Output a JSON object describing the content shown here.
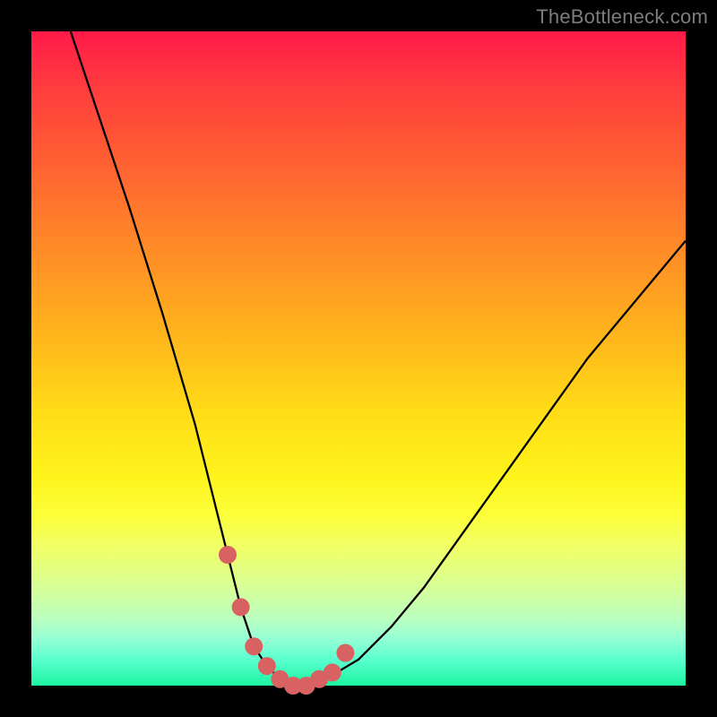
{
  "watermark": "TheBottleneck.com",
  "colors": {
    "background": "#000000",
    "gradient_top": "#ff1a49",
    "gradient_mid": "#ffdc18",
    "gradient_bottom": "#1cf5a1",
    "curve": "#000000",
    "marker": "#d86262"
  },
  "chart_data": {
    "type": "line",
    "title": "",
    "xlabel": "",
    "ylabel": "",
    "xlim": [
      0,
      100
    ],
    "ylim": [
      0,
      100
    ],
    "grid": false,
    "legend": false,
    "series": [
      {
        "name": "bottleneck-curve",
        "x": [
          6,
          10,
          15,
          20,
          25,
          28,
          30,
          32,
          34,
          36,
          38,
          40,
          42,
          45,
          50,
          55,
          60,
          65,
          70,
          75,
          80,
          85,
          90,
          95,
          100
        ],
        "values": [
          100,
          88,
          73,
          57,
          40,
          28,
          20,
          12,
          6,
          3,
          1,
          0,
          0,
          1,
          4,
          9,
          15,
          22,
          29,
          36,
          43,
          50,
          56,
          62,
          68
        ]
      }
    ],
    "markers": {
      "name": "highlighted-points",
      "x": [
        30,
        32,
        34,
        36,
        38,
        40,
        42,
        44,
        46,
        48
      ],
      "values": [
        20,
        12,
        6,
        3,
        1,
        0,
        0,
        1,
        2,
        5
      ]
    }
  }
}
